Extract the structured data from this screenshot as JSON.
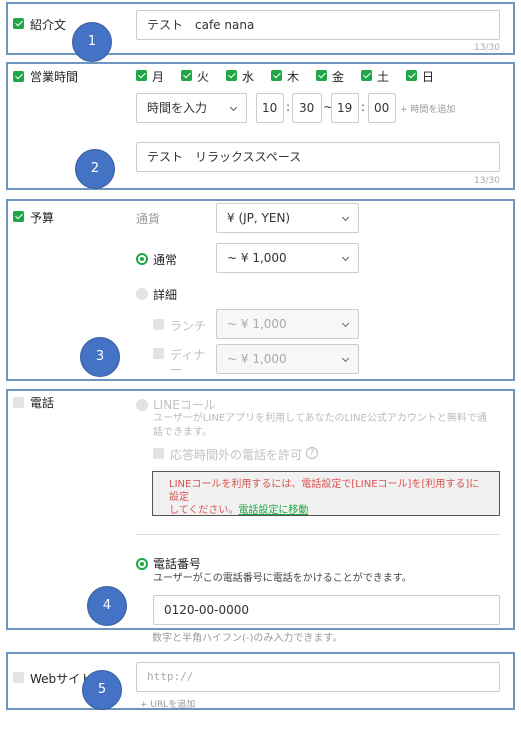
{
  "intro": {
    "label": "紹介文",
    "value": "テスト　cafe nana",
    "counter": "13/30",
    "badge": "1"
  },
  "hours": {
    "label": "営業時間",
    "days": [
      "月",
      "火",
      "水",
      "木",
      "金",
      "土",
      "日"
    ],
    "mode": "時間を入力",
    "start_hour": "10",
    "start_min": "30",
    "tilde": "~",
    "colon": ":",
    "end_hour": "19",
    "end_min": "00",
    "add_time": "+ 時間を追加",
    "note": "テスト　リラックススペース",
    "counter": "13/30",
    "badge": "2"
  },
  "budget": {
    "label": "予算",
    "currency_label": "通貨",
    "currency_value": "¥ (JP, YEN)",
    "normal_label": "通常",
    "normal_value": "~ ¥ 1,000",
    "detail_label": "詳細",
    "lunch_label": "ランチ",
    "lunch_value": "~ ¥ 1,000",
    "dinner_label_1": "ディナ",
    "dinner_label_2": "ー",
    "dinner_value": "~ ¥ 1,000",
    "badge": "3"
  },
  "phone": {
    "label": "電話",
    "line_call_label": "LINEコール",
    "line_call_help_1": "ユーザーがLINEアプリを利用してあなたのLINE公式アカウントと無料で通",
    "line_call_help_2": "話できます。",
    "after_hours_label": "応答時間外の電話を許可",
    "help_icon": "?",
    "notice_1": "LINEコールを利用するには、電話設定で[LINEコール]を[利用する]に設定",
    "notice_2": "してください。",
    "notice_link": "電話設定に移動",
    "phone_number_label": "電話番号",
    "phone_number_help": "ユーザーがこの電話番号に電話をかけることができます。",
    "phone_number_value": "0120-00-0000",
    "footer_help": "数字と半角ハイフン(-)のみ入力できます。",
    "badge": "4"
  },
  "website": {
    "label": "Webサイト",
    "placeholder": "http://",
    "add_url": "+ URLを追加",
    "badge": "5"
  },
  "colors": {
    "accent_green": "#1fa645",
    "border_blue": "#6e95bd",
    "badge_blue": "#4472c4",
    "notice_red": "#d9534f"
  }
}
